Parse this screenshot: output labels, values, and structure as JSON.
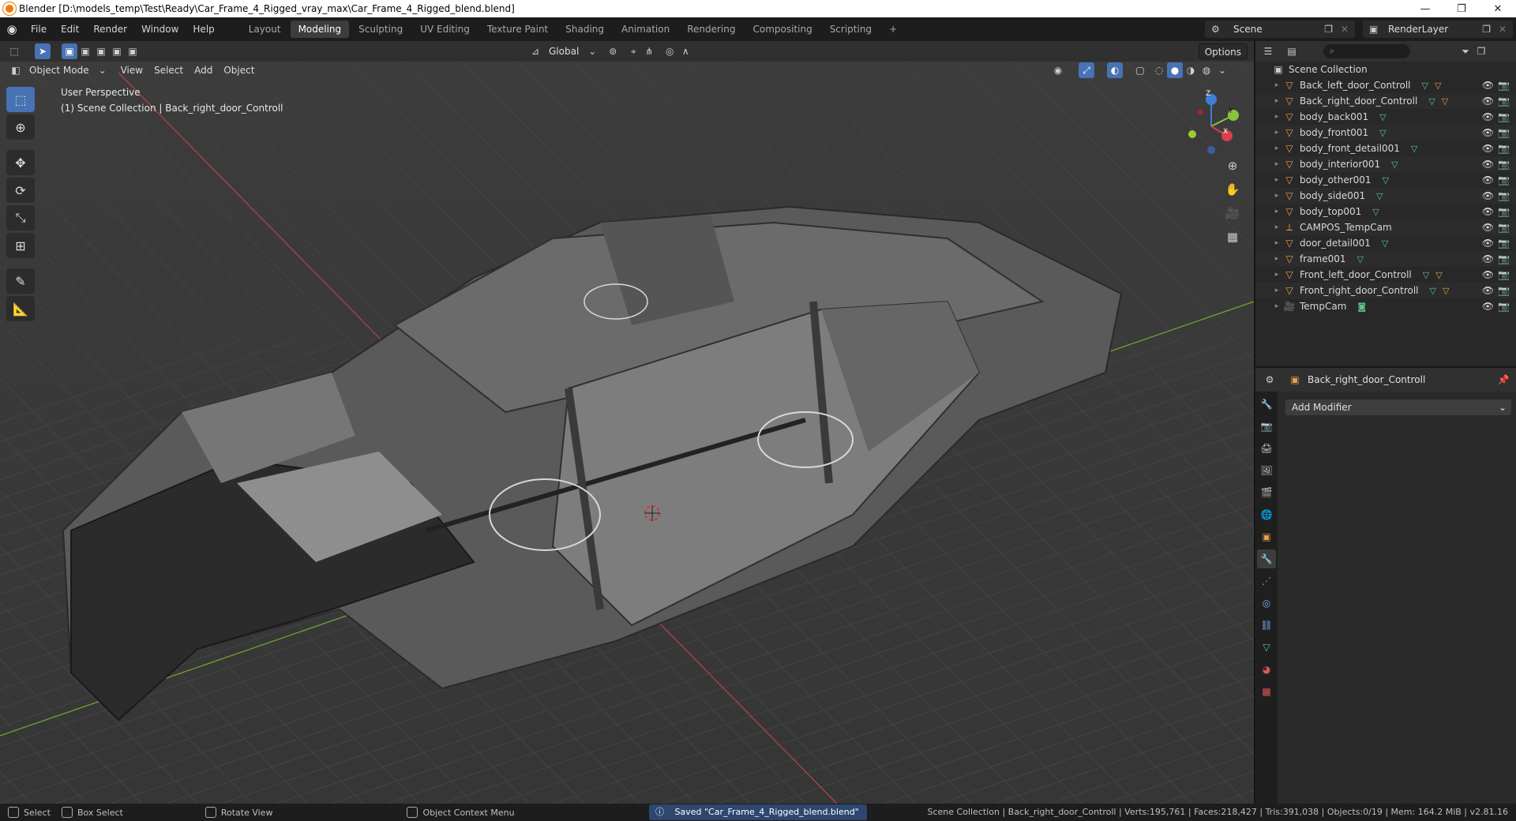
{
  "window": {
    "title": "Blender [D:\\models_temp\\Test\\Ready\\Car_Frame_4_Rigged_vray_max\\Car_Frame_4_Rigged_blend.blend]",
    "minimize": "—",
    "maximize": "❐",
    "close": "✕"
  },
  "menu": [
    "File",
    "Edit",
    "Render",
    "Window",
    "Help"
  ],
  "workspaces": [
    {
      "label": "Layout",
      "active": false
    },
    {
      "label": "Modeling",
      "active": true
    },
    {
      "label": "Sculpting",
      "active": false
    },
    {
      "label": "UV Editing",
      "active": false
    },
    {
      "label": "Texture Paint",
      "active": false
    },
    {
      "label": "Shading",
      "active": false
    },
    {
      "label": "Animation",
      "active": false
    },
    {
      "label": "Rendering",
      "active": false
    },
    {
      "label": "Compositing",
      "active": false
    },
    {
      "label": "Scripting",
      "active": false
    }
  ],
  "add_workspace": "+",
  "scene": "Scene",
  "render_layer": "RenderLayer",
  "viewport_header": {
    "transform_orientation": "Global",
    "options": "Options",
    "mode": "Object Mode",
    "menus": [
      "View",
      "Select",
      "Add",
      "Object"
    ]
  },
  "viewport": {
    "perspective": "User Perspective",
    "collection_info": "(1) Scene Collection | Back_right_door_Controll",
    "gizmo": {
      "z": "Z",
      "y": "Y",
      "x": "X"
    }
  },
  "outliner": {
    "root": "Scene Collection",
    "items": [
      {
        "name": "Back_left_door_Controll",
        "type": "mesh",
        "extras": [
          "mesh",
          "armature"
        ],
        "selected": false
      },
      {
        "name": "Back_right_door_Controll",
        "type": "mesh",
        "extras": [
          "mesh",
          "armature"
        ],
        "selected": false
      },
      {
        "name": "body_back001",
        "type": "mesh",
        "extras": [
          "mesh"
        ],
        "selected": false
      },
      {
        "name": "body_front001",
        "type": "mesh",
        "extras": [
          "mesh"
        ],
        "selected": false
      },
      {
        "name": "body_front_detail001",
        "type": "mesh",
        "extras": [
          "mesh"
        ],
        "selected": false
      },
      {
        "name": "body_interior001",
        "type": "mesh",
        "extras": [
          "mesh"
        ],
        "selected": false
      },
      {
        "name": "body_other001",
        "type": "mesh",
        "extras": [
          "mesh"
        ],
        "selected": false
      },
      {
        "name": "body_side001",
        "type": "mesh",
        "extras": [
          "mesh"
        ],
        "selected": false
      },
      {
        "name": "body_top001",
        "type": "mesh",
        "extras": [
          "mesh"
        ],
        "selected": false
      },
      {
        "name": "CAMPOS_TempCam",
        "type": "empty",
        "extras": [],
        "selected": false
      },
      {
        "name": "door_detail001",
        "type": "mesh",
        "extras": [
          "mesh"
        ],
        "selected": false
      },
      {
        "name": "frame001",
        "type": "mesh",
        "extras": [
          "mesh"
        ],
        "selected": false
      },
      {
        "name": "Front_left_door_Controll",
        "type": "mesh",
        "extras": [
          "mesh",
          "armature"
        ],
        "selected": false
      },
      {
        "name": "Front_right_door_Controll",
        "type": "mesh",
        "extras": [
          "mesh",
          "armature"
        ],
        "selected": false
      },
      {
        "name": "TempCam",
        "type": "camera",
        "extras": [
          "camera-data"
        ],
        "selected": false
      }
    ]
  },
  "properties": {
    "object_name": "Back_right_door_Controll",
    "add_modifier": "Add Modifier"
  },
  "statusbar": {
    "select": "Select",
    "box_select": "Box Select",
    "rotate_view": "Rotate View",
    "context_menu": "Object Context Menu",
    "saved_message": "Saved \"Car_Frame_4_Rigged_blend.blend\"",
    "stats": "Scene Collection | Back_right_door_Controll | Verts:195,761 | Faces:218,427 | Tris:391,038 | Objects:0/19 | Mem: 164.2 MiB | v2.81.16"
  },
  "colors": {
    "accent": "#4772b3",
    "x_axis": "#d9404a",
    "y_axis": "#8ac43f",
    "z_axis": "#3f7fd9",
    "object_orange": "#e8a14d",
    "mesh_green": "#5fc28d"
  }
}
